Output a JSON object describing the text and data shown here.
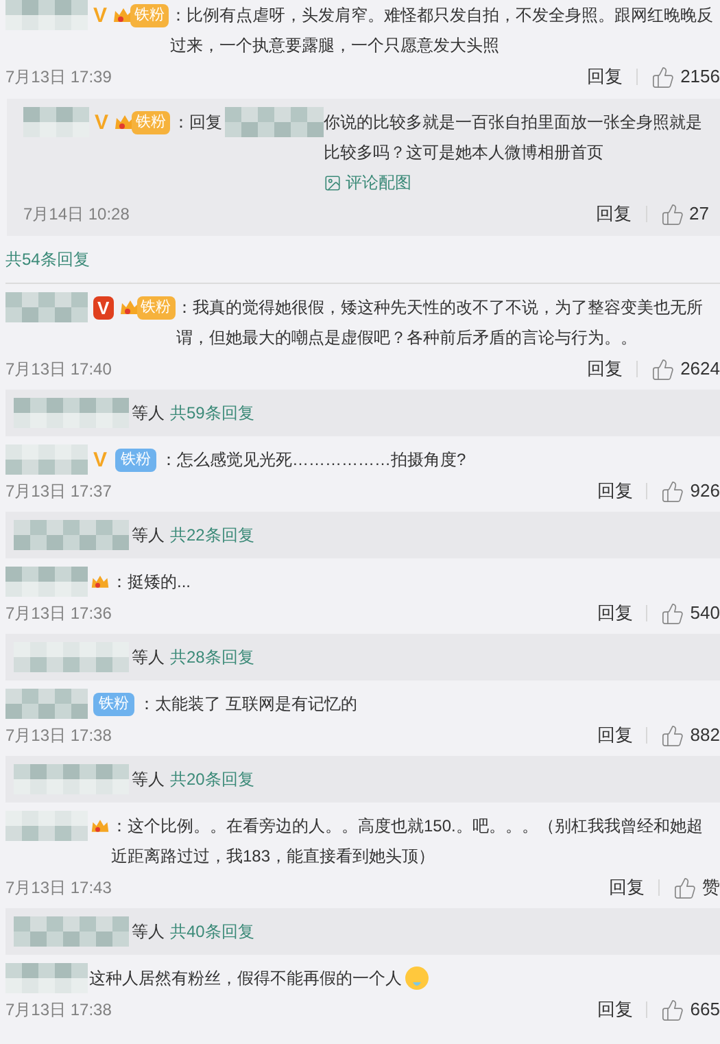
{
  "comments": [
    {
      "badges": [
        {
          "kind": "vip_yellow",
          "label": "V"
        },
        {
          "kind": "fan_crown",
          "label": "铁粉"
        }
      ],
      "text": "：比例有点虐呀，头发肩窄。难怪都只发自拍，不发全身照。跟网红晚晚反过来，一个执意要露腿，一个只愿意发大头照",
      "time": "7月13日 17:39",
      "reply_label": "回复",
      "likes": "2156",
      "replies": [
        {
          "badges": [
            {
              "kind": "vip_yellow",
              "label": "V"
            },
            {
              "kind": "fan_crown",
              "label": "铁粉"
            }
          ],
          "prefix": "：回复",
          "text": "你说的比较多就是一百张自拍里面放一张全身照就是比较多吗？这可是她本人微博相册首页",
          "image_link": "评论配图",
          "time": "7月14日 10:28",
          "reply_label": "回复",
          "likes": "27"
        }
      ],
      "more_link": "共54条回复"
    },
    {
      "badges": [
        {
          "kind": "vip_red",
          "label": "V"
        },
        {
          "kind": "fan_crown",
          "label": "铁粉"
        }
      ],
      "text": "：我真的觉得她很假，矮这种先天性的改不了不说，为了整容变美也无所谓，但她最大的嘲点是虚假吧？各种前后矛盾的言论与行为。。",
      "time": "7月13日 17:40",
      "reply_label": "回复",
      "likes": "2624",
      "summary": {
        "suffix": "等人",
        "link": "共59条回复"
      }
    },
    {
      "badges": [
        {
          "kind": "vip_yellow",
          "label": "V"
        },
        {
          "kind": "fan_blue",
          "label": "铁粉"
        }
      ],
      "text": "：怎么感觉见光死………………拍摄角度?",
      "time": "7月13日 17:37",
      "reply_label": "回复",
      "likes": "926",
      "summary": {
        "suffix": "等人",
        "link": "共22条回复"
      }
    },
    {
      "badges": [
        {
          "kind": "crown"
        }
      ],
      "text": "：挺矮的...",
      "time": "7月13日 17:36",
      "reply_label": "回复",
      "likes": "540",
      "summary": {
        "suffix": "等人",
        "link": "共28条回复"
      }
    },
    {
      "badges": [
        {
          "kind": "fan_blue",
          "label": "铁粉"
        }
      ],
      "text": "：太能装了 互联网是有记忆的",
      "time": "7月13日 17:38",
      "reply_label": "回复",
      "likes": "882",
      "summary": {
        "suffix": "等人",
        "link": "共20条回复"
      }
    },
    {
      "badges": [
        {
          "kind": "crown"
        }
      ],
      "text": "：这个比例。。在看旁边的人。。高度也就150.。吧。。。（别杠我我曾经和她超近距离路过过，我183，能直接看到她头顶）",
      "time": "7月13日 17:43",
      "reply_label": "回复",
      "likes": "赞",
      "summary": {
        "suffix": "等人",
        "link": "共40条回复"
      }
    },
    {
      "text": "这种人居然有粉丝，假得不能再假的一个人",
      "emoji": true,
      "time": "7月13日 17:38",
      "reply_label": "回复",
      "likes": "665"
    }
  ]
}
